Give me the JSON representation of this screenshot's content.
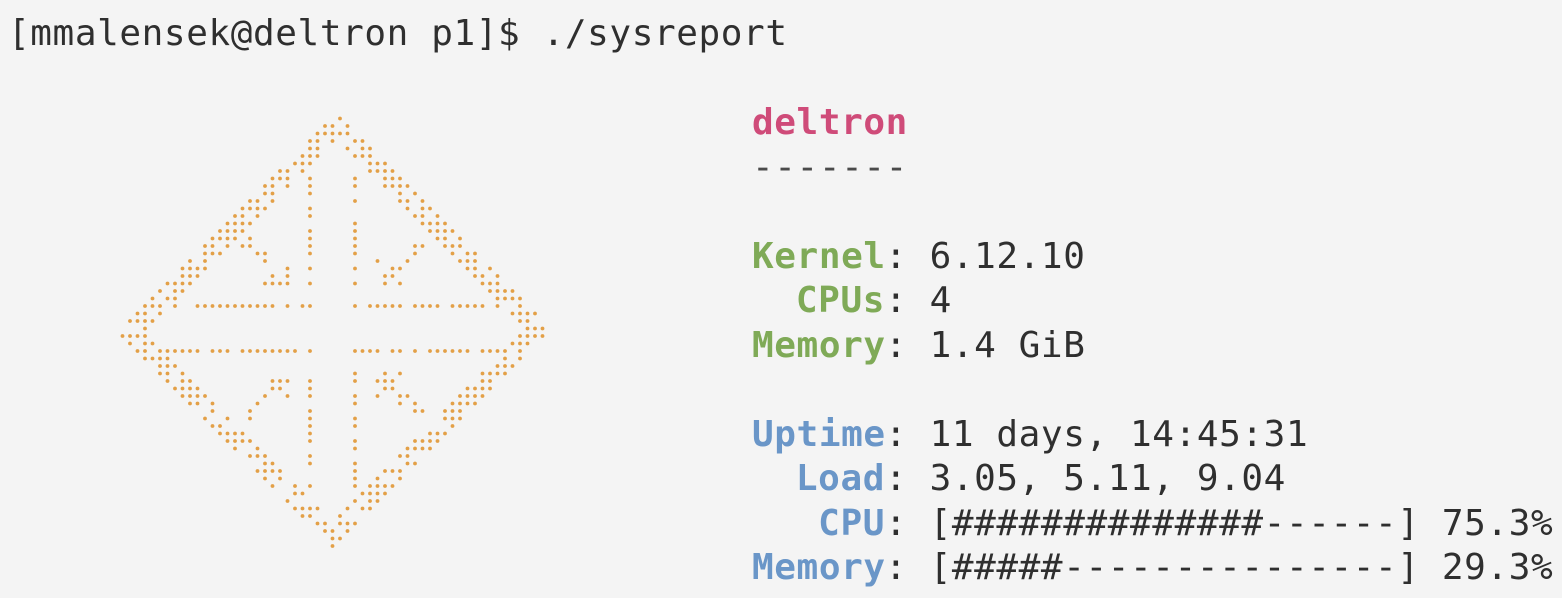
{
  "terminal": {
    "prompt": "[mmalensek@deltron p1]$",
    "command": "./sysreport"
  },
  "logo": {
    "icon": "fedora-like-dotted-logo-icon",
    "color": "#e3a047"
  },
  "info": {
    "hostname": "deltron",
    "separator": "-------",
    "kernel_label": "Kernel",
    "kernel_value": "6.12.10",
    "cpus_label": "CPUs",
    "cpus_value": "4",
    "memory_label": "Memory",
    "memory_value": "1.4 GiB",
    "uptime_label": "Uptime",
    "uptime_value": "11 days, 14:45:31",
    "load_label": "Load",
    "load_value": "3.05, 5.11, 9.04",
    "cpu_label": "CPU",
    "cpu_bar": "[##############------]",
    "cpu_percent": "75.3%",
    "memory_usage_label": "Memory",
    "memory_bar": "[#####---------------]",
    "memory_percent": "29.3%"
  },
  "colors": {
    "hostname": "#cf4b79",
    "hardware_labels": "#7faa57",
    "runtime_labels": "#6a96c8",
    "logo_dots": "#e3a047",
    "background": "#f4f4f4",
    "text": "#2f2f2f"
  }
}
